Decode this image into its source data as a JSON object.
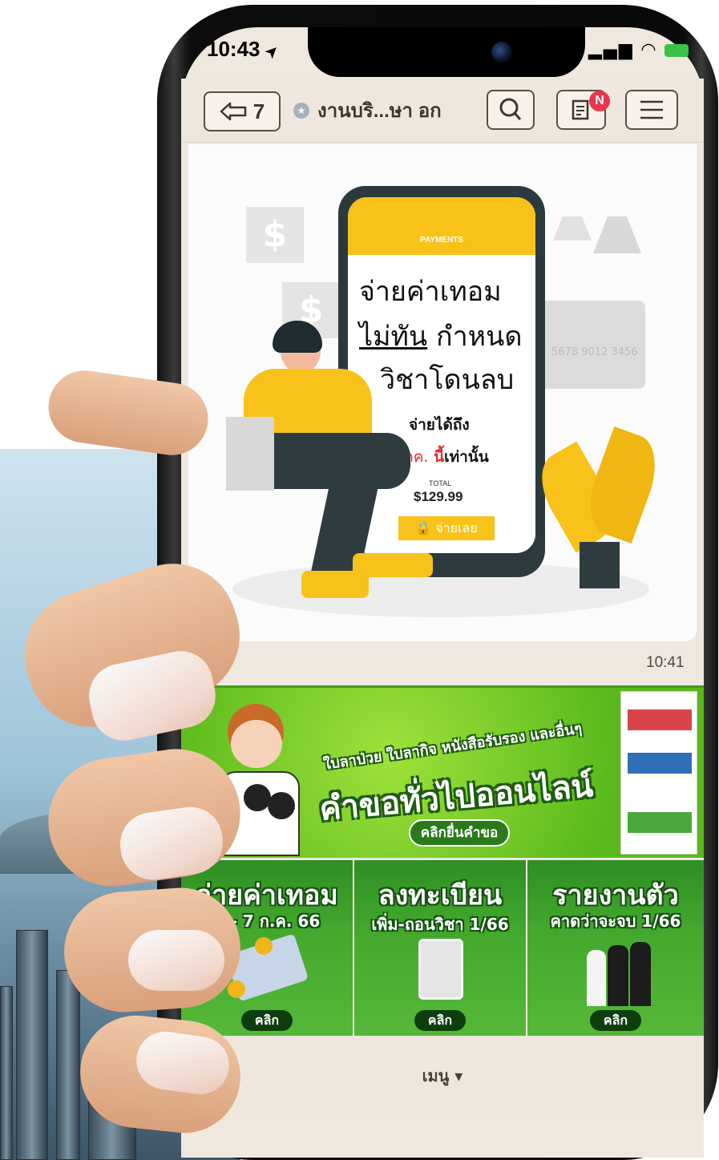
{
  "status_bar": {
    "time": "10:43",
    "location_arrow": "➤",
    "signal_wifi_battery": "▮▮▯ ◠ ⚡"
  },
  "nav": {
    "back_label": "7",
    "chat_title": "งานบริ...ษา อก",
    "notes_badge": "N"
  },
  "chat": {
    "image_card": {
      "mock_header": "PAYMENTS",
      "line1": "จ่ายค่าเทอม",
      "line2_underlined": "ไม่ทัน",
      "line2_rest": "กำหนด",
      "line3": "วิชาโดนลบ",
      "pay_until": "จ่ายได้ถึง",
      "deadline_red": "14 กค.",
      "deadline_red2": "นี้",
      "deadline_rest": "เท่านั้น",
      "total_label": "TOTAL",
      "total_value": "$129.99",
      "pay_button": "จ่ายเลย",
      "card_number": "5678 9012 3456"
    },
    "time": "10:41"
  },
  "rich_menu": {
    "banner": {
      "subtitle": "ใบลาป่วย ใบลากิจ หนังสือรับรอง และอื่นๆ",
      "title": "คำขอทั่วไปออนไลน์",
      "cta": "คลิกยื่นคำขอ"
    },
    "tiles": [
      {
        "title": "จ่ายค่าเทอม",
        "subtitle": "3 - 7 ก.ค. 66",
        "button": "คลิก"
      },
      {
        "title": "ลงทะเบียน",
        "subtitle": "เพิ่ม-ถอนวิชา 1/66",
        "button": "คลิก"
      },
      {
        "title": "รายงานตัว",
        "subtitle": "คาดว่าจะจบ 1/66",
        "button": "คลิก"
      }
    ]
  },
  "bottom_menu": {
    "label": "เมนู ▾"
  },
  "colors": {
    "accent_yellow": "#f8c21b",
    "green": "#43a82d",
    "red": "#e8282c",
    "nav_bg": "#efe7de"
  }
}
